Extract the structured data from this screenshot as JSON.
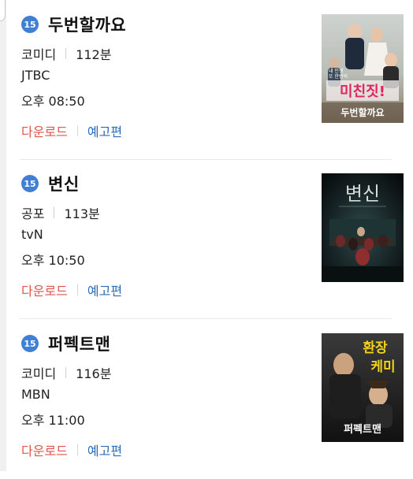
{
  "items": [
    {
      "rating": "15",
      "title": "두번할까요",
      "genre": "코미디",
      "runtime": "112분",
      "channel": "JTBC",
      "time": "오후 08:50",
      "download_label": "다운로드",
      "trailer_label": "예고편",
      "poster_text": "미친짓!",
      "poster_title": "두번할까요",
      "poster_tagline": "내 인생\n또 한번의"
    },
    {
      "rating": "15",
      "title": "변신",
      "genre": "공포",
      "runtime": "113분",
      "channel": "tvN",
      "time": "오후 10:50",
      "download_label": "다운로드",
      "trailer_label": "예고편",
      "poster_text": "변신"
    },
    {
      "rating": "15",
      "title": "퍼펙트맨",
      "genre": "코미디",
      "runtime": "116분",
      "channel": "MBN",
      "time": "오후 11:00",
      "download_label": "다운로드",
      "trailer_label": "예고편",
      "poster_text": "환장 케미",
      "poster_title": "퍼펙트맨"
    }
  ],
  "colors": {
    "badge": "#3f7fd4",
    "download": "#e2544b",
    "trailer": "#2a6cb8"
  }
}
